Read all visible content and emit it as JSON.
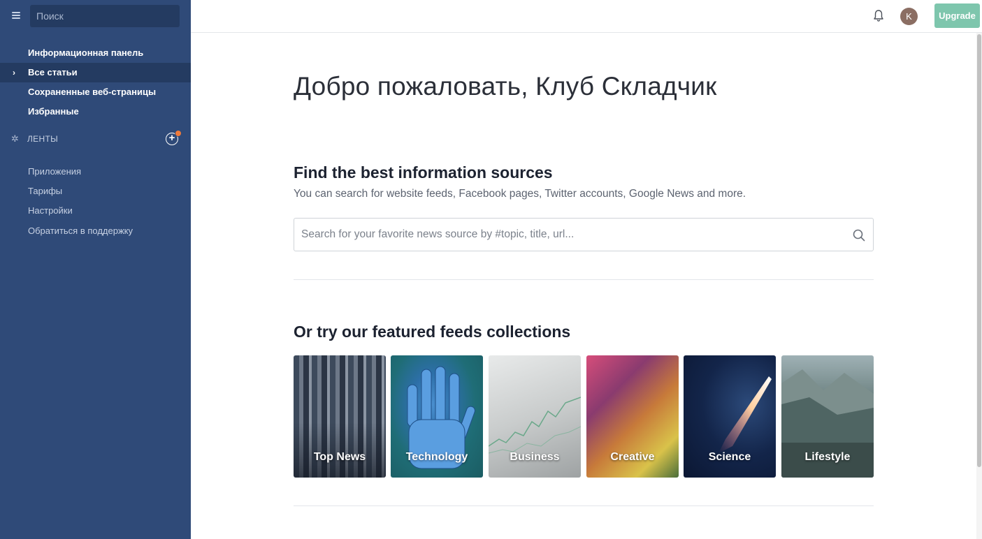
{
  "sidebar": {
    "search_placeholder": "Поиск",
    "nav": [
      {
        "label": "Информационная панель",
        "active": false
      },
      {
        "label": "Все статьи",
        "active": true
      },
      {
        "label": "Сохраненные веб-страницы",
        "active": false
      },
      {
        "label": "Избранные",
        "active": false
      }
    ],
    "feeds_label": "ЛЕНТЫ",
    "add_label": "+",
    "links": [
      {
        "label": "Приложения"
      },
      {
        "label": "Тарифы"
      },
      {
        "label": "Настройки"
      },
      {
        "label": "Обратиться в поддержку"
      }
    ],
    "colors": {
      "background": "#2f4a78",
      "active": "#243b61",
      "badge": "#f07a3a"
    }
  },
  "topbar": {
    "avatar_initial": "K",
    "upgrade_label": "Upgrade",
    "colors": {
      "upgrade": "#7ec6ad",
      "avatar": "#8b6e63"
    }
  },
  "main": {
    "welcome": "Добро пожаловать, Клуб Складчик",
    "find_title": "Find the best information sources",
    "find_subtitle": "You can search for website feeds, Facebook pages, Twitter accounts, Google News and more.",
    "search_placeholder": "Search for your favorite news source by #topic, title, url...",
    "featured_title": "Or try our featured feeds collections",
    "collections": [
      {
        "label": "Top News"
      },
      {
        "label": "Technology"
      },
      {
        "label": "Business"
      },
      {
        "label": "Creative"
      },
      {
        "label": "Science"
      },
      {
        "label": "Lifestyle"
      }
    ]
  }
}
